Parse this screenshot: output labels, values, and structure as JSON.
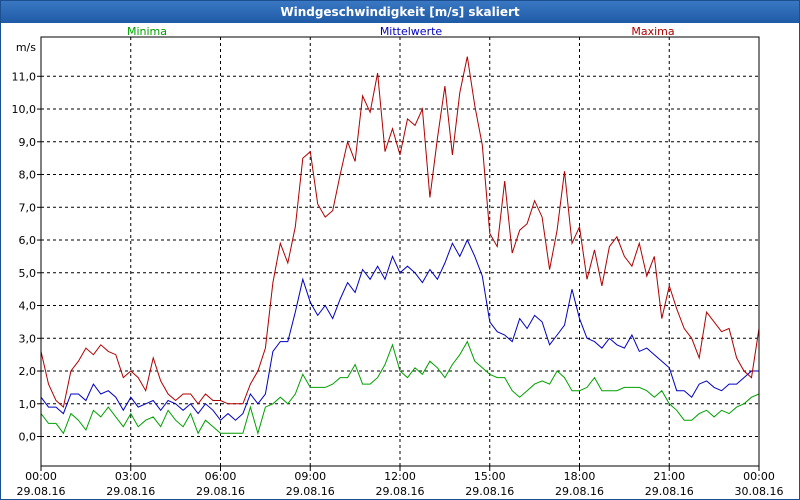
{
  "window": {
    "title": "Windgeschwindigkeit [m/s] skaliert"
  },
  "chart_data": {
    "type": "line",
    "title": "Windgeschwindigkeit [m/s] skaliert",
    "ylabel": "m/s",
    "ylim": [
      -0.9,
      12.2
    ],
    "xlim_hours": [
      0,
      24
    ],
    "yticks": [
      "0,0",
      "1,0",
      "2,0",
      "3,0",
      "4,0",
      "5,0",
      "6,0",
      "7,0",
      "8,0",
      "9,0",
      "10,0",
      "11,0"
    ],
    "xticks": [
      {
        "time": "00:00",
        "date": "29.08.16"
      },
      {
        "time": "03:00",
        "date": "29.08.16"
      },
      {
        "time": "06:00",
        "date": "29.08.16"
      },
      {
        "time": "09:00",
        "date": "29.08.16"
      },
      {
        "time": "12:00",
        "date": "29.08.16"
      },
      {
        "time": "15:00",
        "date": "29.08.16"
      },
      {
        "time": "18:00",
        "date": "29.08.16"
      },
      {
        "time": "21:00",
        "date": "29.08.16"
      },
      {
        "time": "00:00",
        "date": "30.08.16"
      }
    ],
    "grid": true,
    "legend_position": "top",
    "series": [
      {
        "name": "Minima",
        "color": "#00a000",
        "points": [
          [
            0,
            0.7
          ],
          [
            0.25,
            0.4
          ],
          [
            0.5,
            0.4
          ],
          [
            0.75,
            0.1
          ],
          [
            1,
            0.7
          ],
          [
            1.25,
            0.5
          ],
          [
            1.5,
            0.2
          ],
          [
            1.75,
            0.8
          ],
          [
            2,
            0.6
          ],
          [
            2.25,
            0.9
          ],
          [
            2.5,
            0.6
          ],
          [
            2.75,
            0.3
          ],
          [
            3,
            0.7
          ],
          [
            3.25,
            0.3
          ],
          [
            3.5,
            0.5
          ],
          [
            3.75,
            0.6
          ],
          [
            4,
            0.3
          ],
          [
            4.25,
            0.8
          ],
          [
            4.5,
            0.5
          ],
          [
            4.75,
            0.3
          ],
          [
            5,
            0.7
          ],
          [
            5.25,
            0.1
          ],
          [
            5.5,
            0.5
          ],
          [
            5.75,
            0.3
          ],
          [
            6,
            0.1
          ],
          [
            6.25,
            0.1
          ],
          [
            6.5,
            0.1
          ],
          [
            6.75,
            0.1
          ],
          [
            7,
            0.9
          ],
          [
            7.25,
            0.1
          ],
          [
            7.5,
            0.9
          ],
          [
            7.75,
            1.0
          ],
          [
            8,
            1.2
          ],
          [
            8.25,
            1.0
          ],
          [
            8.5,
            1.3
          ],
          [
            8.75,
            1.9
          ],
          [
            9,
            1.5
          ],
          [
            9.25,
            1.5
          ],
          [
            9.5,
            1.5
          ],
          [
            9.75,
            1.6
          ],
          [
            10,
            1.8
          ],
          [
            10.25,
            1.8
          ],
          [
            10.5,
            2.2
          ],
          [
            10.75,
            1.6
          ],
          [
            11,
            1.6
          ],
          [
            11.25,
            1.8
          ],
          [
            11.5,
            2.2
          ],
          [
            11.75,
            2.8
          ],
          [
            12,
            2.0
          ],
          [
            12.25,
            1.8
          ],
          [
            12.5,
            2.1
          ],
          [
            12.75,
            1.9
          ],
          [
            13,
            2.3
          ],
          [
            13.25,
            2.1
          ],
          [
            13.5,
            1.8
          ],
          [
            13.75,
            2.2
          ],
          [
            14,
            2.5
          ],
          [
            14.25,
            2.9
          ],
          [
            14.5,
            2.3
          ],
          [
            14.75,
            2.1
          ],
          [
            15,
            1.9
          ],
          [
            15.25,
            1.8
          ],
          [
            15.5,
            1.8
          ],
          [
            15.75,
            1.4
          ],
          [
            16,
            1.2
          ],
          [
            16.25,
            1.4
          ],
          [
            16.5,
            1.6
          ],
          [
            16.75,
            1.7
          ],
          [
            17,
            1.6
          ],
          [
            17.25,
            2.0
          ],
          [
            17.5,
            1.8
          ],
          [
            17.75,
            1.4
          ],
          [
            18,
            1.4
          ],
          [
            18.25,
            1.5
          ],
          [
            18.5,
            1.8
          ],
          [
            18.75,
            1.4
          ],
          [
            19,
            1.4
          ],
          [
            19.25,
            1.4
          ],
          [
            19.5,
            1.5
          ],
          [
            19.75,
            1.5
          ],
          [
            20,
            1.5
          ],
          [
            20.25,
            1.4
          ],
          [
            20.5,
            1.2
          ],
          [
            20.75,
            1.4
          ],
          [
            21,
            1.0
          ],
          [
            21.25,
            0.8
          ],
          [
            21.5,
            0.5
          ],
          [
            21.75,
            0.5
          ],
          [
            22,
            0.7
          ],
          [
            22.25,
            0.8
          ],
          [
            22.5,
            0.6
          ],
          [
            22.75,
            0.8
          ],
          [
            23,
            0.7
          ],
          [
            23.25,
            0.9
          ],
          [
            23.5,
            1.0
          ],
          [
            23.75,
            1.2
          ],
          [
            24,
            1.3
          ]
        ]
      },
      {
        "name": "Mittelwerte",
        "color": "#0000c0",
        "points": [
          [
            0,
            1.2
          ],
          [
            0.25,
            0.9
          ],
          [
            0.5,
            0.9
          ],
          [
            0.75,
            0.7
          ],
          [
            1,
            1.3
          ],
          [
            1.25,
            1.3
          ],
          [
            1.5,
            1.1
          ],
          [
            1.75,
            1.6
          ],
          [
            2,
            1.3
          ],
          [
            2.25,
            1.4
          ],
          [
            2.5,
            1.2
          ],
          [
            2.75,
            0.8
          ],
          [
            3,
            1.2
          ],
          [
            3.25,
            0.9
          ],
          [
            3.5,
            1.0
          ],
          [
            3.75,
            1.1
          ],
          [
            4,
            0.8
          ],
          [
            4.25,
            1.1
          ],
          [
            4.5,
            1.0
          ],
          [
            4.75,
            0.8
          ],
          [
            5,
            1.0
          ],
          [
            5.25,
            0.7
          ],
          [
            5.5,
            1.0
          ],
          [
            5.75,
            0.8
          ],
          [
            6,
            0.5
          ],
          [
            6.25,
            0.7
          ],
          [
            6.5,
            0.5
          ],
          [
            6.75,
            0.7
          ],
          [
            7,
            1.3
          ],
          [
            7.25,
            1.0
          ],
          [
            7.5,
            1.3
          ],
          [
            7.75,
            2.6
          ],
          [
            8,
            2.9
          ],
          [
            8.25,
            2.9
          ],
          [
            8.5,
            3.8
          ],
          [
            8.75,
            4.8
          ],
          [
            9,
            4.1
          ],
          [
            9.25,
            3.7
          ],
          [
            9.5,
            4.0
          ],
          [
            9.75,
            3.6
          ],
          [
            10,
            4.2
          ],
          [
            10.25,
            4.7
          ],
          [
            10.5,
            4.4
          ],
          [
            10.75,
            5.1
          ],
          [
            11,
            4.8
          ],
          [
            11.25,
            5.2
          ],
          [
            11.5,
            4.8
          ],
          [
            11.75,
            5.5
          ],
          [
            12,
            5.0
          ],
          [
            12.25,
            5.2
          ],
          [
            12.5,
            5.0
          ],
          [
            12.75,
            4.7
          ],
          [
            13,
            5.1
          ],
          [
            13.25,
            4.8
          ],
          [
            13.5,
            5.3
          ],
          [
            13.75,
            5.9
          ],
          [
            14,
            5.5
          ],
          [
            14.25,
            6.0
          ],
          [
            14.5,
            5.5
          ],
          [
            14.75,
            4.9
          ],
          [
            15,
            3.5
          ],
          [
            15.25,
            3.2
          ],
          [
            15.5,
            3.1
          ],
          [
            15.75,
            2.9
          ],
          [
            16,
            3.6
          ],
          [
            16.25,
            3.3
          ],
          [
            16.5,
            3.7
          ],
          [
            16.75,
            3.5
          ],
          [
            17,
            2.8
          ],
          [
            17.25,
            3.1
          ],
          [
            17.5,
            3.4
          ],
          [
            17.75,
            4.5
          ],
          [
            18,
            3.6
          ],
          [
            18.25,
            3.0
          ],
          [
            18.5,
            2.9
          ],
          [
            18.75,
            2.7
          ],
          [
            19,
            3.0
          ],
          [
            19.25,
            2.8
          ],
          [
            19.5,
            2.7
          ],
          [
            19.75,
            3.1
          ],
          [
            20,
            2.6
          ],
          [
            20.25,
            2.7
          ],
          [
            20.5,
            2.5
          ],
          [
            20.75,
            2.3
          ],
          [
            21,
            2.1
          ],
          [
            21.25,
            1.4
          ],
          [
            21.5,
            1.4
          ],
          [
            21.75,
            1.2
          ],
          [
            22,
            1.6
          ],
          [
            22.25,
            1.7
          ],
          [
            22.5,
            1.5
          ],
          [
            22.75,
            1.4
          ],
          [
            23,
            1.6
          ],
          [
            23.25,
            1.6
          ],
          [
            23.5,
            1.8
          ],
          [
            23.75,
            2.0
          ],
          [
            24,
            2.0
          ]
        ]
      },
      {
        "name": "Maxima",
        "color": "#b00000",
        "points": [
          [
            0,
            2.6
          ],
          [
            0.25,
            1.6
          ],
          [
            0.5,
            1.1
          ],
          [
            0.75,
            0.9
          ],
          [
            1,
            2.0
          ],
          [
            1.25,
            2.3
          ],
          [
            1.5,
            2.7
          ],
          [
            1.75,
            2.5
          ],
          [
            2,
            2.8
          ],
          [
            2.25,
            2.6
          ],
          [
            2.5,
            2.5
          ],
          [
            2.75,
            1.8
          ],
          [
            3,
            2.0
          ],
          [
            3.25,
            1.8
          ],
          [
            3.5,
            1.4
          ],
          [
            3.75,
            2.4
          ],
          [
            4,
            1.7
          ],
          [
            4.25,
            1.3
          ],
          [
            4.5,
            1.1
          ],
          [
            4.75,
            1.3
          ],
          [
            5,
            1.3
          ],
          [
            5.25,
            1.0
          ],
          [
            5.5,
            1.3
          ],
          [
            5.75,
            1.1
          ],
          [
            6,
            1.1
          ],
          [
            6.25,
            1.0
          ],
          [
            6.5,
            1.0
          ],
          [
            6.75,
            1.0
          ],
          [
            7,
            1.6
          ],
          [
            7.25,
            2.0
          ],
          [
            7.5,
            2.7
          ],
          [
            7.75,
            4.7
          ],
          [
            8,
            5.9
          ],
          [
            8.25,
            5.3
          ],
          [
            8.5,
            6.4
          ],
          [
            8.75,
            8.5
          ],
          [
            9,
            8.7
          ],
          [
            9.25,
            7.1
          ],
          [
            9.5,
            6.7
          ],
          [
            9.75,
            6.9
          ],
          [
            10,
            8.0
          ],
          [
            10.25,
            9.0
          ],
          [
            10.5,
            8.4
          ],
          [
            10.75,
            10.4
          ],
          [
            11,
            9.9
          ],
          [
            11.25,
            11.1
          ],
          [
            11.5,
            8.7
          ],
          [
            11.75,
            9.4
          ],
          [
            12,
            8.6
          ],
          [
            12.25,
            9.7
          ],
          [
            12.5,
            9.5
          ],
          [
            12.75,
            10.0
          ],
          [
            13,
            7.3
          ],
          [
            13.25,
            9.1
          ],
          [
            13.5,
            10.7
          ],
          [
            13.75,
            8.6
          ],
          [
            14,
            10.5
          ],
          [
            14.25,
            11.6
          ],
          [
            14.5,
            10.1
          ],
          [
            14.75,
            8.9
          ],
          [
            15,
            6.2
          ],
          [
            15.25,
            5.8
          ],
          [
            15.5,
            7.8
          ],
          [
            15.75,
            5.6
          ],
          [
            16,
            6.3
          ],
          [
            16.25,
            6.5
          ],
          [
            16.5,
            7.2
          ],
          [
            16.75,
            6.7
          ],
          [
            17,
            5.1
          ],
          [
            17.25,
            6.3
          ],
          [
            17.5,
            8.1
          ],
          [
            17.75,
            5.9
          ],
          [
            18,
            6.4
          ],
          [
            18.25,
            4.8
          ],
          [
            18.25,
            4.8
          ],
          [
            18.5,
            5.7
          ],
          [
            18.75,
            4.6
          ],
          [
            19,
            5.8
          ],
          [
            19.25,
            6.1
          ],
          [
            19.5,
            5.5
          ],
          [
            19.75,
            5.2
          ],
          [
            20,
            5.9
          ],
          [
            20.25,
            4.9
          ],
          [
            20.5,
            5.5
          ],
          [
            20.75,
            3.6
          ],
          [
            21,
            4.6
          ],
          [
            21.25,
            3.9
          ],
          [
            21.5,
            3.3
          ],
          [
            21.75,
            3.0
          ],
          [
            22,
            2.4
          ],
          [
            22.25,
            3.8
          ],
          [
            22.5,
            3.5
          ],
          [
            22.75,
            3.2
          ],
          [
            23,
            3.3
          ],
          [
            23.25,
            2.4
          ],
          [
            23.5,
            2.0
          ],
          [
            23.75,
            1.8
          ],
          [
            24,
            3.3
          ]
        ]
      }
    ]
  }
}
